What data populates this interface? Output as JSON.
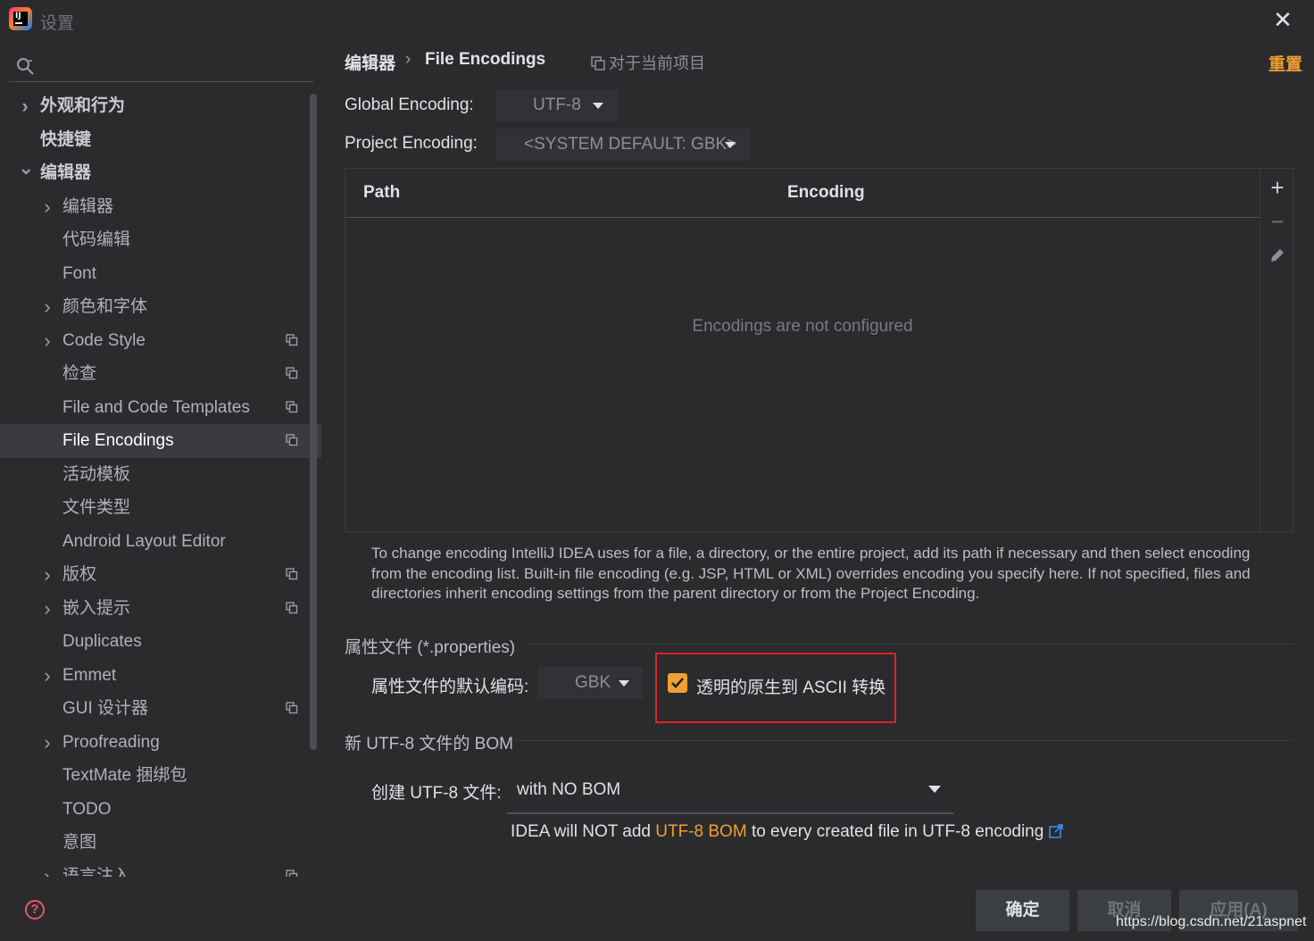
{
  "window": {
    "title": "设置",
    "close_glyph": "✕"
  },
  "search": {
    "placeholder": ""
  },
  "sidebar": {
    "items": [
      {
        "label": "外观和行为",
        "level": 0,
        "expander": "collapsed",
        "project_icon": false
      },
      {
        "label": "快捷键",
        "level": 0,
        "expander": "none",
        "project_icon": false
      },
      {
        "label": "编辑器",
        "level": 0,
        "expander": "expanded",
        "project_icon": false
      },
      {
        "label": "编辑器",
        "level": 1,
        "expander": "collapsed",
        "project_icon": false
      },
      {
        "label": "代码编辑",
        "level": 1,
        "expander": "none",
        "project_icon": false
      },
      {
        "label": "Font",
        "level": 1,
        "expander": "none",
        "project_icon": false
      },
      {
        "label": "颜色和字体",
        "level": 1,
        "expander": "collapsed",
        "project_icon": false
      },
      {
        "label": "Code Style",
        "level": 1,
        "expander": "collapsed",
        "project_icon": true
      },
      {
        "label": "检查",
        "level": 1,
        "expander": "none",
        "project_icon": true
      },
      {
        "label": "File and Code Templates",
        "level": 1,
        "expander": "none",
        "project_icon": true
      },
      {
        "label": "File Encodings",
        "level": 1,
        "expander": "none",
        "project_icon": true,
        "selected": true
      },
      {
        "label": "活动模板",
        "level": 1,
        "expander": "none",
        "project_icon": false
      },
      {
        "label": "文件类型",
        "level": 1,
        "expander": "none",
        "project_icon": false
      },
      {
        "label": "Android Layout Editor",
        "level": 1,
        "expander": "none",
        "project_icon": false
      },
      {
        "label": "版权",
        "level": 1,
        "expander": "collapsed",
        "project_icon": true
      },
      {
        "label": "嵌入提示",
        "level": 1,
        "expander": "collapsed",
        "project_icon": true
      },
      {
        "label": "Duplicates",
        "level": 1,
        "expander": "none",
        "project_icon": false
      },
      {
        "label": "Emmet",
        "level": 1,
        "expander": "collapsed",
        "project_icon": false
      },
      {
        "label": "GUI 设计器",
        "level": 1,
        "expander": "none",
        "project_icon": true
      },
      {
        "label": "Proofreading",
        "level": 1,
        "expander": "collapsed",
        "project_icon": false
      },
      {
        "label": "TextMate 捆绑包",
        "level": 1,
        "expander": "none",
        "project_icon": false
      },
      {
        "label": "TODO",
        "level": 1,
        "expander": "none",
        "project_icon": false
      },
      {
        "label": "意图",
        "level": 1,
        "expander": "none",
        "project_icon": false
      },
      {
        "label": "语言注入",
        "level": 1,
        "expander": "collapsed",
        "project_icon": true
      }
    ]
  },
  "header": {
    "breadcrumb_parent": "编辑器",
    "breadcrumb_separator": "›",
    "breadcrumb_current": "File Encodings",
    "scope_label": "对于当前项目",
    "reset_label": "重置"
  },
  "encodings": {
    "global_label": "Global Encoding:",
    "global_value": "UTF-8",
    "project_label": "Project Encoding:",
    "project_value": "<SYSTEM DEFAULT: GBK>"
  },
  "table": {
    "columns": [
      "Path",
      "Encoding"
    ],
    "empty_text": "Encodings are not configured",
    "tools": {
      "add": "+",
      "remove": "−"
    }
  },
  "help_text": "To change encoding IntelliJ IDEA uses for a file, a directory, or the entire project, add its path if necessary and then select encoding from the encoding list. Built-in file encoding (e.g. JSP, HTML or XML) overrides encoding you specify here. If not specified, files and directories inherit encoding settings from the parent directory or from the Project Encoding.",
  "properties": {
    "group_title": "属性文件 (*.properties)",
    "default_encoding_label": "属性文件的默认编码:",
    "default_encoding_value": "GBK",
    "ascii_checkbox_label": "透明的原生到 ASCII 转换",
    "ascii_checked": true
  },
  "bom": {
    "group_title": "新 UTF-8 文件的 BOM",
    "create_label": "创建 UTF-8 文件:",
    "create_value": "with NO BOM",
    "note_prefix": "IDEA will NOT add",
    "note_highlight": "UTF-8 BOM",
    "note_suffix": "to every created file in UTF-8 encoding"
  },
  "buttons": {
    "ok": "确定",
    "cancel": "取消",
    "apply": "应用(A)"
  },
  "watermark": "https://blog.csdn.net/21aspnet",
  "colors": {
    "accent": "#f0a030",
    "background": "#2b2b2d",
    "selection": "#393b40",
    "highlight_box": "#e0202a",
    "link_icon": "#3592ff"
  }
}
